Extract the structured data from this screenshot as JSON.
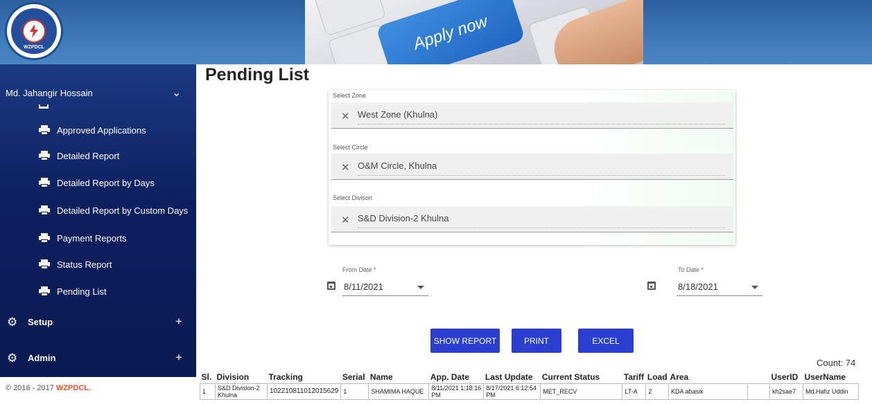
{
  "header": {
    "logo_text": "WZPDCL",
    "banner_text": "Apply now"
  },
  "sidebar": {
    "user_name": "Md. Jahangir Hossain",
    "items": [
      {
        "label": "Approved Applications"
      },
      {
        "label": "Detailed Report"
      },
      {
        "label": "Detailed Report by Days"
      },
      {
        "label": "Detailed Report by Custom Days"
      },
      {
        "label": "Payment Reports"
      },
      {
        "label": "Status Report"
      },
      {
        "label": "Pending List"
      }
    ],
    "sections": [
      {
        "label": "Setup",
        "icon": "gear-icon"
      },
      {
        "label": "Admin",
        "icon": "gear-icon"
      }
    ],
    "footer": {
      "text": "© 2016 - 2017 ",
      "brand": "WZPDCL."
    }
  },
  "page": {
    "title": "Pending List"
  },
  "filters": {
    "zone": {
      "label": "Select Zone",
      "value": "West Zone (Khulna)"
    },
    "circle": {
      "label": "Select Circle",
      "value": "O&M Circle, Khulna"
    },
    "division": {
      "label": "Select Divison",
      "value": "S&D Division-2 Khulna"
    }
  },
  "dates": {
    "from": {
      "label": "From Date *",
      "value": "8/11/2021"
    },
    "to": {
      "label": "To Date *",
      "value": "8/18/2021"
    }
  },
  "buttons": {
    "show_report": "SHOW REPORT",
    "print": "PRINT",
    "excel": "EXCEL"
  },
  "count": "Count: 74",
  "table": {
    "columns": [
      "Sl.",
      "Division",
      "Tracking",
      "Serial",
      "Name",
      "App. Date",
      "Last Update",
      "Current Status",
      "Tariff",
      "Load",
      "Area",
      "",
      "UserID",
      "UserName"
    ],
    "rows": [
      [
        "1",
        "S&D Division-2 Khulna",
        "102210811012015629",
        "1",
        "SHAMIMA HAQUE",
        "8/11/2021 1:18:16 PM",
        "8/17/2021 6:12:54 PM",
        "MET_RECV",
        "LT-A",
        "2",
        "KDA abasik",
        "",
        "kh2sae7",
        "Md.Hafiz Uddin"
      ]
    ]
  },
  "colors": {
    "sidebar": "#0c1f5e",
    "button": "#2a3fcf",
    "brand": "#e8532a"
  }
}
